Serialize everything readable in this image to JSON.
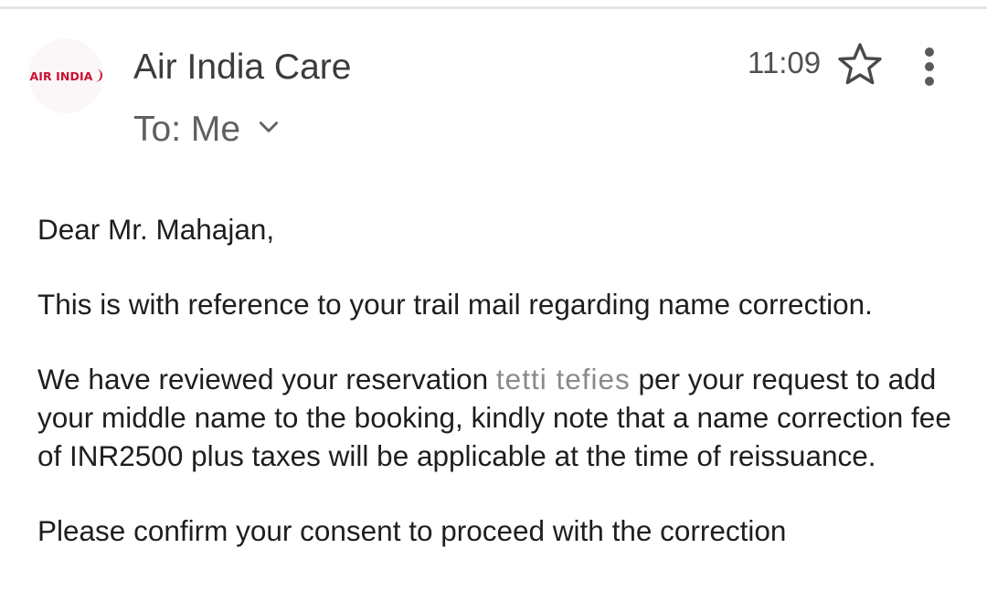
{
  "sender": {
    "avatar_logo_text": "AIR INDIA",
    "name": "Air India Care"
  },
  "recipient": {
    "label": "To: Me"
  },
  "header": {
    "time": "11:09"
  },
  "icons": {
    "avatar": "air-india-logo",
    "expand": "chevron-down-icon",
    "star": "star-outline-icon",
    "more": "vertical-dots-icon"
  },
  "colors": {
    "brand_red": "#c8102e",
    "text_primary": "#1e1e1e",
    "text_secondary": "#5f5f5f"
  },
  "message": {
    "greeting": "Dear Mr. Mahajan,",
    "paragraph1": "This is with reference to your trail mail regarding name correction.",
    "paragraph2_before": "We have reviewed your reservation ",
    "paragraph2_redacted": "tetti tefies",
    "paragraph2_after": " per your request to add your middle name to the booking, kindly note that a name correction fee of INR2500 plus taxes will be applicable at the time of reissuance.",
    "paragraph3_partial": "Please confirm your consent to proceed with the correction"
  }
}
